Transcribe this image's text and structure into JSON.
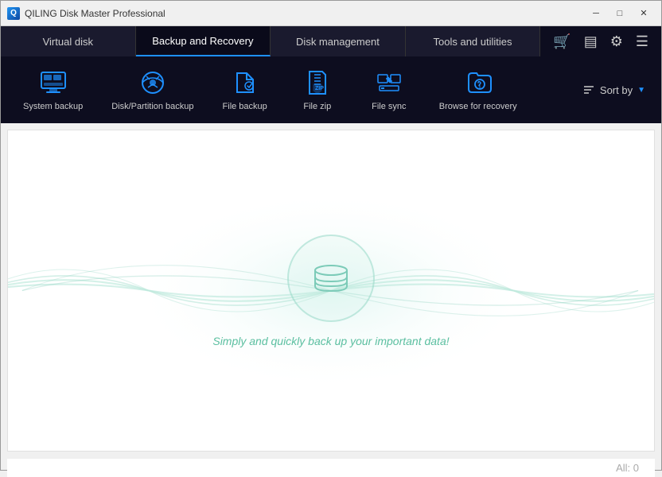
{
  "titleBar": {
    "appName": "QILING Disk Master Professional",
    "minBtn": "─",
    "maxBtn": "□",
    "closeBtn": "✕"
  },
  "mainNav": {
    "tabs": [
      {
        "id": "virtual-disk",
        "label": "Virtual disk",
        "active": false
      },
      {
        "id": "backup-recovery",
        "label": "Backup and Recovery",
        "active": true
      },
      {
        "id": "disk-management",
        "label": "Disk management",
        "active": false
      },
      {
        "id": "tools-utilities",
        "label": "Tools and utilities",
        "active": false
      }
    ]
  },
  "toolbar": {
    "items": [
      {
        "id": "system-backup",
        "label": "System backup",
        "icon": "system-backup-icon"
      },
      {
        "id": "disk-partition-backup",
        "label": "Disk/Partition backup",
        "icon": "disk-partition-icon"
      },
      {
        "id": "file-backup",
        "label": "File backup",
        "icon": "file-backup-icon"
      },
      {
        "id": "file-zip",
        "label": "File zip",
        "icon": "file-zip-icon"
      },
      {
        "id": "file-sync",
        "label": "File sync",
        "icon": "file-sync-icon"
      },
      {
        "id": "browse-recovery",
        "label": "Browse for recovery",
        "icon": "browse-recovery-icon"
      }
    ],
    "sortBy": "Sort by"
  },
  "content": {
    "tagline": "Simply and quickly back up your important data!"
  },
  "footer": {
    "allLabel": "All:",
    "allCount": "0"
  }
}
